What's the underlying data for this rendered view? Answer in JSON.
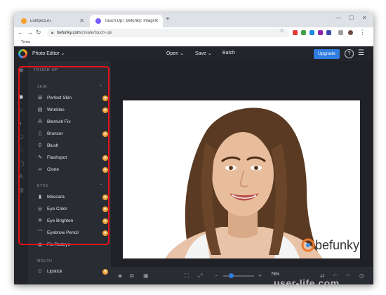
{
  "browser": {
    "tabs": [
      {
        "title": "Lumpics.ru",
        "favicon_color": "#f6a02d"
      },
      {
        "title": "Touch Up | Befunky: Image Retou",
        "favicon_color": "#7a5cff"
      }
    ],
    "new_tab_icon": "+",
    "url_host": "befunky.com",
    "url_path": "/create/touch-up/",
    "bookmark": "Точка"
  },
  "app": {
    "menu_title": "Photo Editor ⌄",
    "open": "Open ⌄",
    "save": "Save ⌄",
    "batch": "Batch",
    "upgrade": "Upgrade",
    "help": "?",
    "panel_title": "TOUCH UP",
    "sections": [
      {
        "name": "SKIN",
        "items": [
          {
            "label": "Perfect Skin",
            "icon": "face-grid-icon",
            "premium": true
          },
          {
            "label": "Wrinkles",
            "icon": "calendar-icon",
            "premium": true
          },
          {
            "label": "Blemish Fix",
            "icon": "dots-icon",
            "premium": false
          },
          {
            "label": "Bronzer",
            "icon": "bottle-icon",
            "premium": true
          },
          {
            "label": "Blush",
            "icon": "brush-icon",
            "premium": false
          },
          {
            "label": "Flashspot",
            "icon": "sparkle-icon",
            "premium": true
          },
          {
            "label": "Clone",
            "icon": "clone-icon",
            "premium": true
          }
        ]
      },
      {
        "name": "EYES",
        "items": [
          {
            "label": "Mascara",
            "icon": "mascara-icon",
            "premium": true
          },
          {
            "label": "Eye Color",
            "icon": "eye-icon",
            "premium": true
          },
          {
            "label": "Eye Brighten",
            "icon": "brighten-icon",
            "premium": true
          },
          {
            "label": "Eyebrow Pencil",
            "icon": "pencil-icon",
            "premium": true
          },
          {
            "label": "Fix Redeye",
            "icon": "redeye-icon",
            "premium": false
          }
        ]
      },
      {
        "name": "MOUTH",
        "items": [
          {
            "label": "Lipstick",
            "icon": "lipstick-icon",
            "premium": true
          }
        ]
      }
    ],
    "zoom": "78%",
    "photo_logo": "befunky",
    "premium_badge": "★"
  },
  "watermark": "user-life.com",
  "accent_color": "#2f7de1",
  "highlight_color": "#e8131b"
}
